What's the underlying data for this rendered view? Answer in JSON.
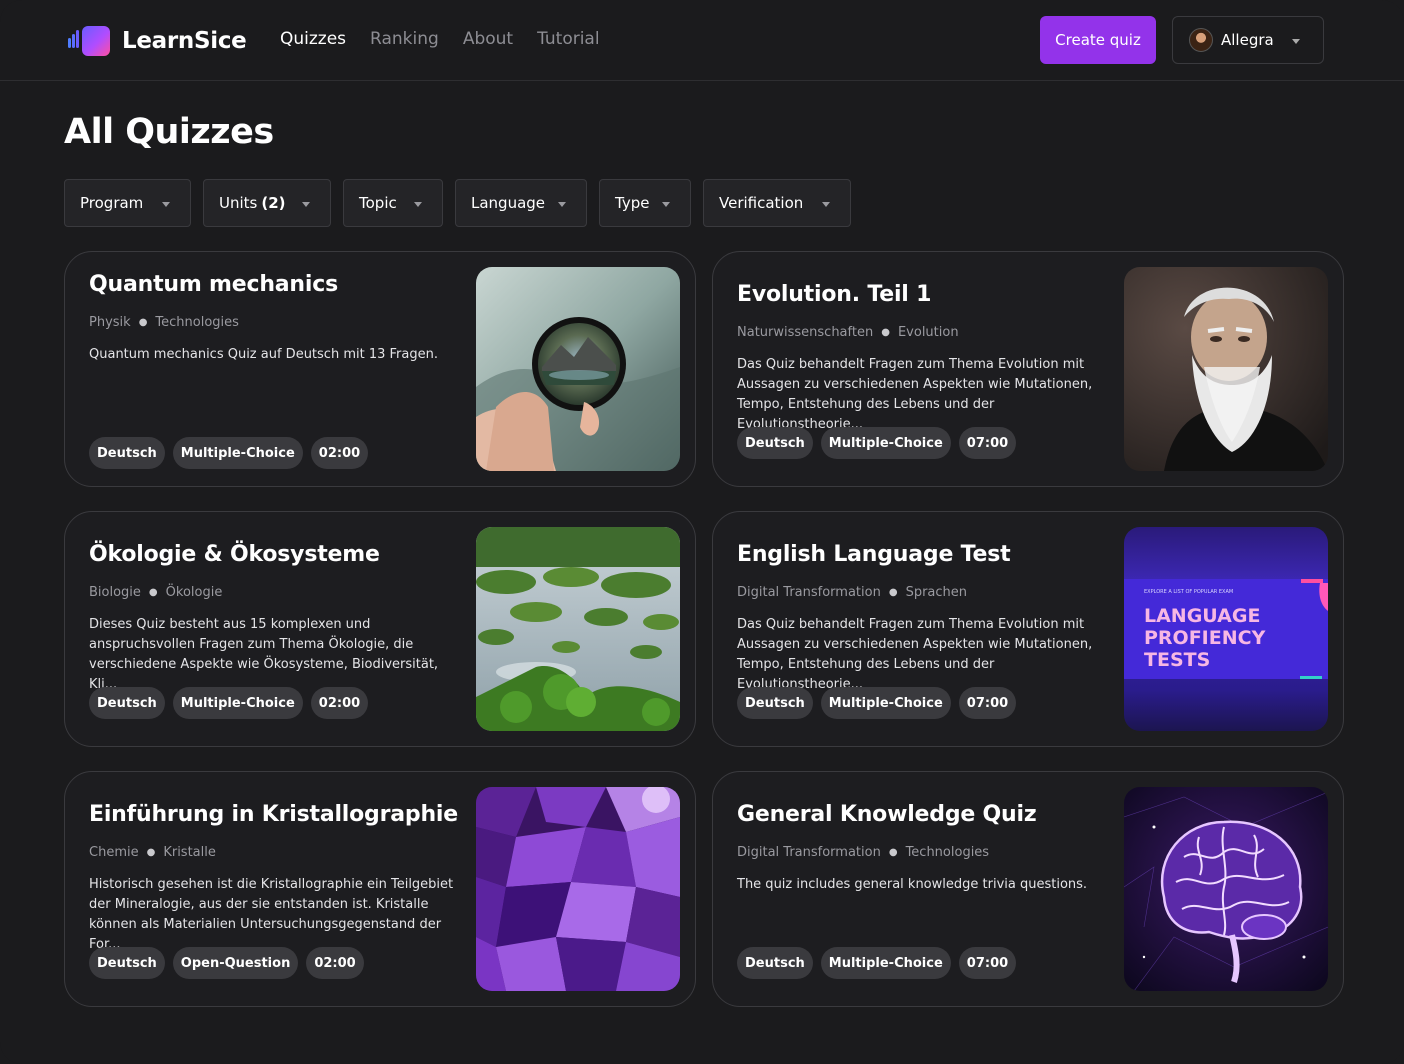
{
  "app": {
    "name": "LearnSice"
  },
  "nav": [
    {
      "label": "Quizzes",
      "active": true
    },
    {
      "label": "Ranking",
      "active": false
    },
    {
      "label": "About",
      "active": false
    },
    {
      "label": "Tutorial",
      "active": false
    }
  ],
  "header": {
    "create_label": "Create quiz",
    "user_name": "Allegra"
  },
  "page": {
    "title": "All Quizzes"
  },
  "filters": [
    {
      "label": "Program",
      "count": ""
    },
    {
      "label": "Units",
      "count": "(2)"
    },
    {
      "label": "Topic",
      "count": ""
    },
    {
      "label": "Language",
      "count": ""
    },
    {
      "label": "Type",
      "count": ""
    },
    {
      "label": "Verification",
      "count": ""
    }
  ],
  "quizzes": [
    {
      "title": "Quantum mechanics",
      "category": "Physik",
      "topic": "Technologies",
      "description": "Quantum mechanics Quiz auf Deutsch mit 13 Fragen.",
      "tags": [
        "Deutsch",
        "Multiple-Choice",
        "02:00"
      ],
      "image": "lens-landscape-image"
    },
    {
      "title": "Evolution. Teil 1",
      "category": "Naturwissenschaften",
      "topic": "Evolution",
      "description": "Das Quiz behandelt Fragen zum Thema Evolution mit Aussagen zu verschiedenen Aspekten wie Mutationen, Tempo, Entstehung des Lebens und der Evolutionstheorie...",
      "tags": [
        "Deutsch",
        "Multiple-Choice",
        "07:00"
      ],
      "image": "bearded-man-portrait-image"
    },
    {
      "title": "Ökologie & Ökosysteme",
      "category": "Biologie",
      "topic": "Ökologie",
      "description": "Dieses Quiz besteht aus 15 komplexen und anspruchsvollen Fragen zum Thema Ökologie, die verschiedene Aspekte wie Ökosysteme, Biodiversität, Kli...",
      "tags": [
        "Deutsch",
        "Multiple-Choice",
        "02:00"
      ],
      "image": "wetland-aerial-image"
    },
    {
      "title": "English Language Test",
      "category": "Digital Transformation",
      "topic": "Sprachen",
      "description": "Das Quiz behandelt Fragen zum Thema Evolution mit Aussagen zu verschiedenen Aspekten wie Mutationen, Tempo, Entstehung des Lebens und der Evolutionstheorie...",
      "tags": [
        "Deutsch",
        "Multiple-Choice",
        "07:00"
      ],
      "image": "language-tests-banner-image",
      "image_text": {
        "small": "EXPLORE A LIST OF POPULAR EXAM",
        "line1": "LANGUAGE",
        "line2": "PROFIENCY",
        "line3": "TESTS"
      }
    },
    {
      "title": "Einführung in Kristallographie",
      "category": "Chemie",
      "topic": "Kristalle",
      "description": "Historisch gesehen ist die Kristallographie ein Teilgebiet der Mineralogie, aus der sie entstanden ist. Kristalle können als Materialien Untersuchungsgegenstand der For...",
      "tags": [
        "Deutsch",
        "Open-Question",
        "02:00"
      ],
      "image": "amethyst-crystal-image"
    },
    {
      "title": "General Knowledge Quiz",
      "category": "Digital Transformation",
      "topic": "Technologies",
      "description": "The quiz includes general knowledge trivia questions.",
      "tags": [
        "Deutsch",
        "Multiple-Choice",
        "07:00"
      ],
      "image": "neon-brain-image"
    }
  ],
  "colors": {
    "accent": "#9333ea",
    "background": "#1b1b1d",
    "tag_bg": "#3a3a3e"
  }
}
